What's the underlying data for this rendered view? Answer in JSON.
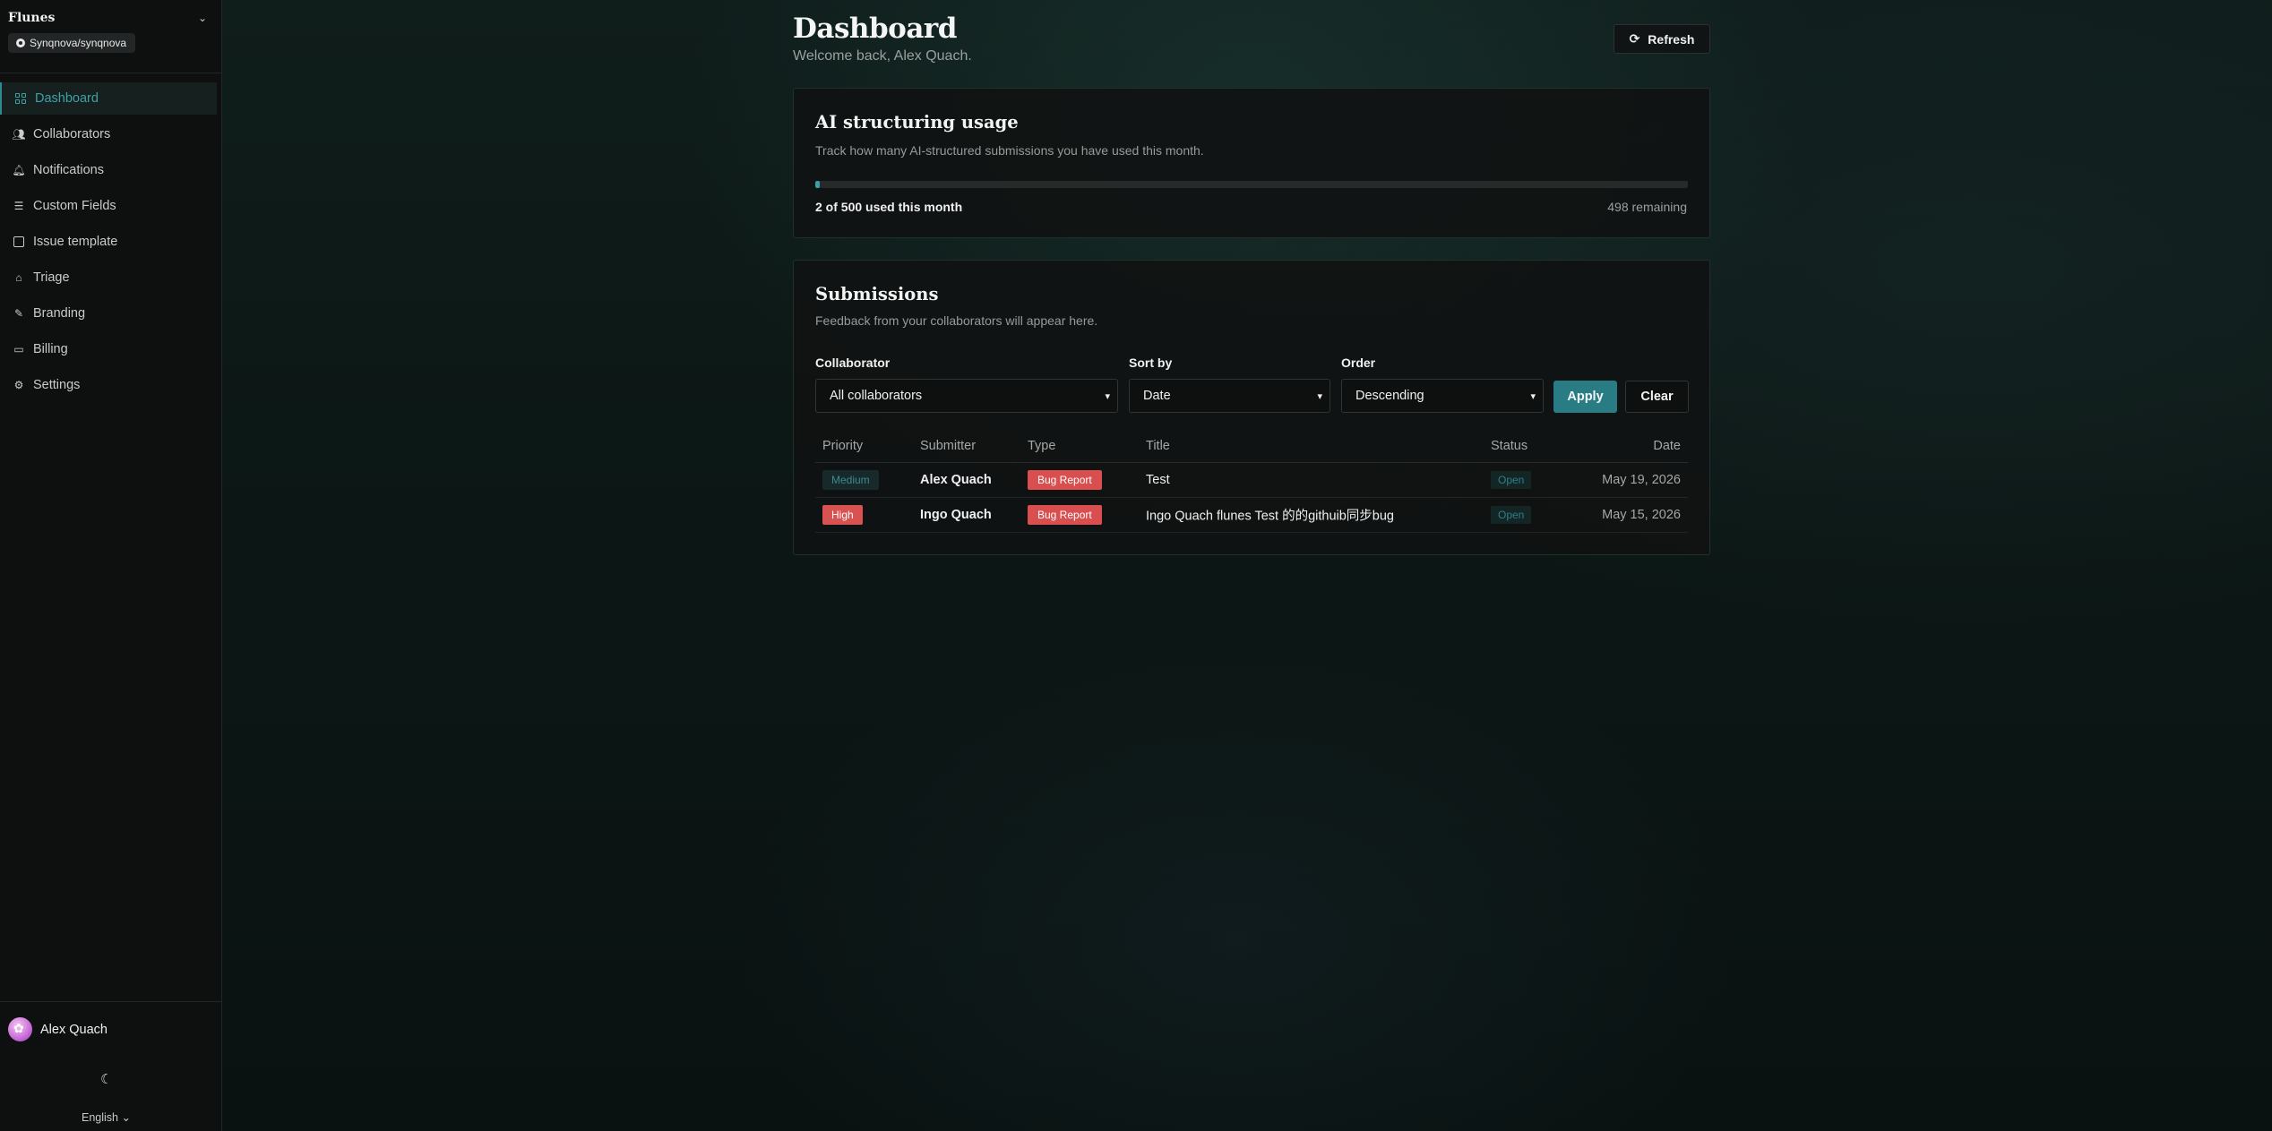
{
  "sidebar": {
    "brand": "Flunes",
    "repo": "Synqnova/synqnova",
    "items": [
      {
        "label": "Dashboard",
        "icon": "dashboard-icon",
        "active": true
      },
      {
        "label": "Collaborators",
        "icon": "users-icon"
      },
      {
        "label": "Notifications",
        "icon": "bell-icon"
      },
      {
        "label": "Custom Fields",
        "icon": "list-icon"
      },
      {
        "label": "Issue template",
        "icon": "file-icon"
      },
      {
        "label": "Triage",
        "icon": "inbox-icon"
      },
      {
        "label": "Branding",
        "icon": "brush-icon"
      },
      {
        "label": "Billing",
        "icon": "card-icon"
      },
      {
        "label": "Settings",
        "icon": "gear-icon"
      }
    ],
    "user_name": "Alex Quach",
    "language": "English"
  },
  "header": {
    "title": "Dashboard",
    "welcome": "Welcome back, Alex Quach.",
    "refresh_label": "Refresh"
  },
  "usage": {
    "title": "AI structuring usage",
    "description": "Track how many AI-structured submissions you have used this month.",
    "used": 2,
    "limit": 500,
    "used_text": "2 of 500 used this month",
    "remaining_text": "498 remaining"
  },
  "submissions": {
    "title": "Submissions",
    "description": "Feedback from your collaborators will appear here.",
    "filters": {
      "collaborator_label": "Collaborator",
      "collaborator_value": "All collaborators",
      "sort_label": "Sort by",
      "sort_value": "Date",
      "order_label": "Order",
      "order_value": "Descending",
      "apply_label": "Apply",
      "clear_label": "Clear"
    },
    "columns": [
      "Priority",
      "Submitter",
      "Type",
      "Title",
      "Status",
      "Date"
    ],
    "rows": [
      {
        "priority": "Medium",
        "submitter": "Alex Quach",
        "type": "Bug Report",
        "title": "Test",
        "status": "Open",
        "date": "May 19, 2026"
      },
      {
        "priority": "High",
        "submitter": "Ingo Quach",
        "type": "Bug Report",
        "title": "Ingo Quach flunes Test 的的githuib同步bug",
        "status": "Open",
        "date": "May 15, 2026"
      }
    ]
  },
  "colors": {
    "accent": "#2a7c84",
    "danger": "#d94f4f",
    "background": "#0b1412"
  }
}
